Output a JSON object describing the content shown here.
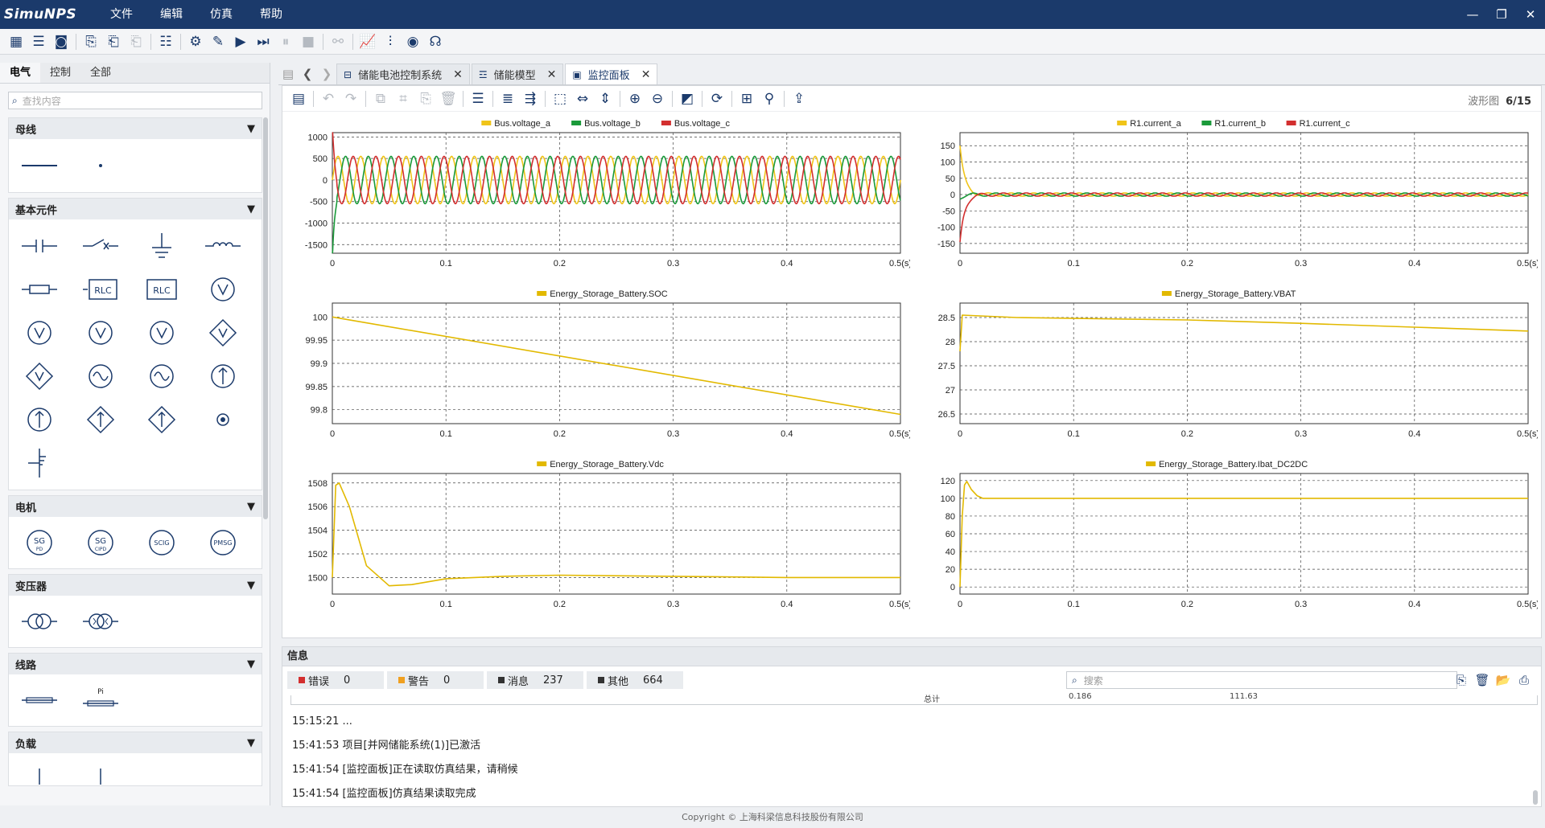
{
  "app": {
    "logo": "SimuNPS",
    "menus": [
      "文件",
      "编辑",
      "仿真",
      "帮助"
    ]
  },
  "window": {
    "minimize": "—",
    "restore": "❐",
    "close": "✕"
  },
  "toolbar": {
    "icons": [
      "grid-icon",
      "list-icon",
      "disk-icon",
      "new-file-icon",
      "open-file-icon",
      "copy-file-icon",
      "settings-icon",
      "capture-icon",
      "edit-icon",
      "run-icon",
      "step-icon",
      "pause-icon",
      "stop-icon",
      "link-icon",
      "chart-icon",
      "sliders-icon",
      "lock-icon",
      "headset-icon"
    ]
  },
  "library": {
    "tabs": [
      "电气",
      "控制",
      "全部"
    ],
    "search_placeholder": "查找内容",
    "categories": [
      {
        "title": "母线",
        "count": 2
      },
      {
        "title": "基本元件",
        "count": 17,
        "labels": [
          "RLC",
          "RLC"
        ]
      },
      {
        "title": "电机",
        "count": 4,
        "labels": [
          "SG PD",
          "SG CIPD",
          "SCIG",
          "PMSG"
        ]
      },
      {
        "title": "变压器",
        "count": 2
      },
      {
        "title": "线路",
        "count": 2,
        "labels": [
          "Pi"
        ]
      },
      {
        "title": "负载",
        "count": 2
      }
    ]
  },
  "doctabs": [
    {
      "label": "储能电池控制系统",
      "close": "✕"
    },
    {
      "label": "储能模型",
      "close": "✕"
    },
    {
      "label": "监控面板",
      "close": "✕"
    }
  ],
  "panel": {
    "count_label": "波形图",
    "count_value": "6/15"
  },
  "chart_data": [
    {
      "type": "line",
      "legend": [
        "Bus.voltage_a",
        "Bus.voltage_b",
        "Bus.voltage_c"
      ],
      "colors": [
        "#f0c419",
        "#1a9a3a",
        "#d32f2f"
      ],
      "x_ticks": [
        "0",
        "0.1",
        "0.2",
        "0.3",
        "0.4",
        "0.5(s)"
      ],
      "y_ticks": [
        "1000",
        "500",
        "0",
        "-500",
        "-1000",
        "-1500"
      ],
      "ylim": [
        -1700,
        1100
      ],
      "xlim": [
        0,
        0.5
      ],
      "kind": "sine3",
      "amplitude": 550,
      "frequency_hz": 50
    },
    {
      "type": "line",
      "legend": [
        "R1.current_a",
        "R1.current_b",
        "R1.current_c"
      ],
      "colors": [
        "#f0c419",
        "#1a9a3a",
        "#d32f2f"
      ],
      "x_ticks": [
        "0",
        "0.1",
        "0.2",
        "0.3",
        "0.4",
        "0.5(s)"
      ],
      "y_ticks": [
        "150",
        "100",
        "50",
        "0",
        "-50",
        "-100",
        "-150"
      ],
      "ylim": [
        -180,
        190
      ],
      "xlim": [
        0,
        0.5
      ],
      "kind": "sine3decay",
      "amplitude": 5,
      "frequency_hz": 50
    },
    {
      "type": "line",
      "legend": [
        "Energy_Storage_Battery.SOC"
      ],
      "colors": [
        "#e2b900"
      ],
      "x_ticks": [
        "0",
        "0.1",
        "0.2",
        "0.3",
        "0.4",
        "0.5(s)"
      ],
      "y_ticks": [
        "100",
        "99.95",
        "99.9",
        "99.85",
        "99.8"
      ],
      "ylim": [
        99.77,
        100.03
      ],
      "xlim": [
        0,
        0.5
      ],
      "points": [
        [
          0,
          100
        ],
        [
          0.5,
          99.79
        ]
      ]
    },
    {
      "type": "line",
      "legend": [
        "Energy_Storage_Battery.VBAT"
      ],
      "colors": [
        "#e2b900"
      ],
      "x_ticks": [
        "0",
        "0.1",
        "0.2",
        "0.3",
        "0.4",
        "0.5(s)"
      ],
      "y_ticks": [
        "28.5",
        "28",
        "27.5",
        "27",
        "26.5"
      ],
      "ylim": [
        26.3,
        28.8
      ],
      "xlim": [
        0,
        0.5
      ],
      "points": [
        [
          0,
          27.8
        ],
        [
          0.002,
          28.55
        ],
        [
          0.05,
          28.5
        ],
        [
          0.2,
          28.45
        ],
        [
          0.3,
          28.38
        ],
        [
          0.4,
          28.3
        ],
        [
          0.5,
          28.22
        ]
      ]
    },
    {
      "type": "line",
      "legend": [
        "Energy_Storage_Battery.Vdc"
      ],
      "colors": [
        "#e2b900"
      ],
      "x_ticks": [
        "0",
        "0.1",
        "0.2",
        "0.3",
        "0.4",
        "0.5(s)"
      ],
      "y_ticks": [
        "1508",
        "1506",
        "1504",
        "1502",
        "1500"
      ],
      "ylim": [
        1498.6,
        1508.8
      ],
      "xlim": [
        0,
        0.5
      ],
      "points": [
        [
          0,
          1500
        ],
        [
          0.003,
          1507.8
        ],
        [
          0.006,
          1508
        ],
        [
          0.015,
          1506
        ],
        [
          0.03,
          1501
        ],
        [
          0.05,
          1499.3
        ],
        [
          0.07,
          1499.4
        ],
        [
          0.1,
          1499.9
        ],
        [
          0.15,
          1500.1
        ],
        [
          0.2,
          1500.2
        ],
        [
          0.3,
          1500.1
        ],
        [
          0.4,
          1500
        ],
        [
          0.5,
          1500
        ]
      ]
    },
    {
      "type": "line",
      "legend": [
        "Energy_Storage_Battery.Ibat_DC2DC"
      ],
      "colors": [
        "#e2b900"
      ],
      "x_ticks": [
        "0",
        "0.1",
        "0.2",
        "0.3",
        "0.4",
        "0.5(s)"
      ],
      "y_ticks": [
        "120",
        "100",
        "80",
        "60",
        "40",
        "20",
        "0"
      ],
      "ylim": [
        -8,
        128
      ],
      "xlim": [
        0,
        0.5
      ],
      "points": [
        [
          0,
          0
        ],
        [
          0.002,
          80
        ],
        [
          0.004,
          115
        ],
        [
          0.006,
          119
        ],
        [
          0.01,
          110
        ],
        [
          0.015,
          103
        ],
        [
          0.02,
          100
        ],
        [
          0.5,
          100
        ]
      ]
    }
  ],
  "info": {
    "title": "信息",
    "tabs": [
      {
        "label": "错误",
        "count": "0",
        "color": "#d32f2f"
      },
      {
        "label": "警告",
        "count": "0",
        "color": "#f0a020"
      },
      {
        "label": "消息",
        "count": "237",
        "color": "#333333"
      },
      {
        "label": "其他",
        "count": "664",
        "color": "#333333"
      }
    ],
    "search_placeholder": "搜索",
    "table_fragments": [
      "总计",
      "0.186",
      "111.63"
    ],
    "log": [
      "15:15:21 ...",
      "15:41:53 项目[并网储能系统(1)]已激活",
      "15:41:54 [监控面板]正在读取仿真结果，请稍候",
      "15:41:54 [监控面板]仿真结果读取完成"
    ]
  },
  "footer": "Copyright © 上海科梁信息科技股份有限公司"
}
